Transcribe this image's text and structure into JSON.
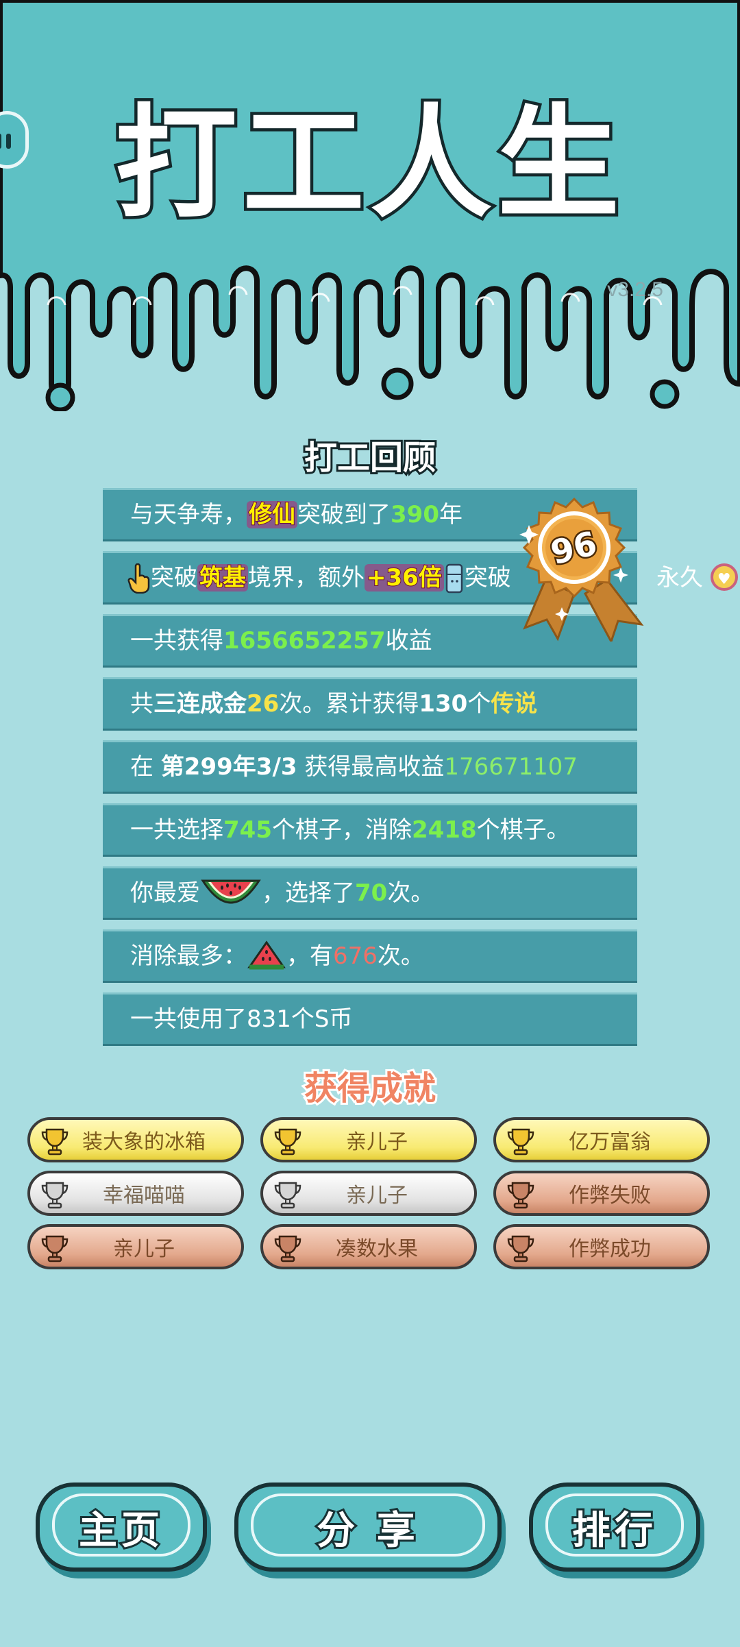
{
  "app": {
    "title": "打工人生",
    "version": "v3.2.5"
  },
  "review": {
    "title": "打工回顾",
    "badge_score": "96",
    "rows": [
      {
        "p1": "与天争寿，",
        "realm": "修仙",
        "p2": "突破到了",
        "years": "390",
        "p3": "年"
      },
      {
        "p1": "突破",
        "realm": "筑基",
        "p2": "境界，额外",
        "bonus": "+36倍",
        "p3": "突破",
        "side": "永久"
      },
      {
        "p1": "一共获得",
        "income": "1656652257",
        "p2": "收益"
      },
      {
        "p1": "共",
        "combo": "三连成金",
        "count": "26",
        "p2": "次。累计获得",
        "legend_count": "130",
        "p3": "个",
        "legend": "传说"
      },
      {
        "p1": "在 ",
        "when": "第299年3/3",
        "p2": " 获得最高收益",
        "max": "176671107"
      },
      {
        "p1": "一共选择",
        "picked": "745",
        "p2": "个棋子，消除",
        "removed": "2418",
        "p3": "个棋子。"
      },
      {
        "p1": "你最爱",
        "p2": "，选择了",
        "times": "70",
        "p3": "次。"
      },
      {
        "p1": "消除最多：",
        "p2": "，有",
        "times": "676",
        "p3": "次。"
      },
      {
        "p1": "一共使用了831个S币"
      }
    ]
  },
  "achievements": {
    "title": "获得成就",
    "items": [
      {
        "label": "装大象的冰箱",
        "tier": "gold"
      },
      {
        "label": "亲儿子",
        "tier": "gold"
      },
      {
        "label": "亿万富翁",
        "tier": "gold"
      },
      {
        "label": "幸福喵喵",
        "tier": "silver"
      },
      {
        "label": "亲儿子",
        "tier": "silver"
      },
      {
        "label": "作弊失败",
        "tier": "bronze"
      },
      {
        "label": "亲儿子",
        "tier": "bronze"
      },
      {
        "label": "凑数水果",
        "tier": "bronze"
      },
      {
        "label": "作弊成功",
        "tier": "bronze"
      }
    ]
  },
  "buttons": {
    "home": "主页",
    "share": "分 享",
    "rank": "排行"
  },
  "icons": [
    "pause-icon",
    "pointing-hand-icon",
    "fridge-icon",
    "medal-icon",
    "heart-coin-icon",
    "watermelon-icon",
    "watermelon-slice-icon",
    "trophy-icon"
  ],
  "colors": {
    "background": "#a9dde1",
    "top_band": "#5ec1c4",
    "row": "#479da8",
    "green_value": "#7cf04c",
    "yellow_value": "#f7e349",
    "red_value": "#f07066"
  }
}
